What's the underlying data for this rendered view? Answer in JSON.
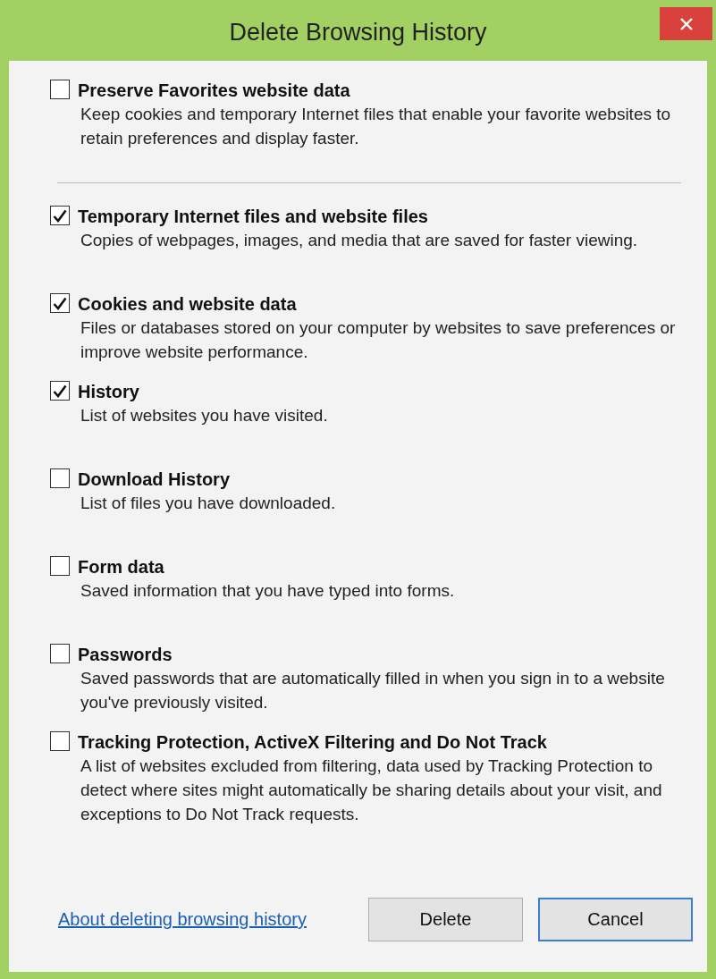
{
  "window": {
    "title": "Delete Browsing History"
  },
  "groups": [
    {
      "items": [
        {
          "label": "Preserve Favorites website data",
          "description": "Keep cookies and temporary Internet files that enable your favorite websites to retain preferences and display faster.",
          "checked": false
        }
      ]
    },
    {
      "items": [
        {
          "label": "Temporary Internet files and website files",
          "description": "Copies of webpages, images, and media that are saved for faster viewing.",
          "checked": true
        },
        {
          "label": "Cookies and website data",
          "description": "Files or databases stored on your computer by websites to save preferences or improve website performance.",
          "checked": true
        },
        {
          "label": "History",
          "description": "List of websites you have visited.",
          "checked": true
        },
        {
          "label": "Download History",
          "description": "List of files you have downloaded.",
          "checked": false
        },
        {
          "label": "Form data",
          "description": "Saved information that you have typed into forms.",
          "checked": false
        },
        {
          "label": "Passwords",
          "description": "Saved passwords that are automatically filled in when you sign in to a website you've previously visited.",
          "checked": false
        },
        {
          "label": "Tracking Protection, ActiveX Filtering and Do Not Track",
          "description": "A list of websites excluded from filtering, data used by Tracking Protection to detect where sites might automatically be sharing details about your visit, and exceptions to Do Not Track requests.",
          "checked": false
        }
      ]
    }
  ],
  "footer": {
    "link": "About deleting browsing history",
    "buttons": [
      {
        "label": "Delete",
        "focused": false
      },
      {
        "label": "Cancel",
        "focused": true
      }
    ]
  }
}
